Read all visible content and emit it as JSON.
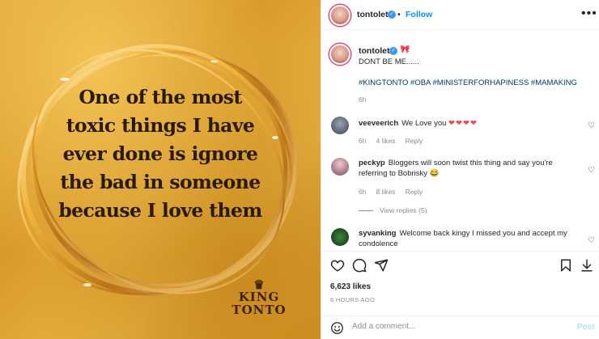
{
  "image": {
    "quote_lines": [
      "One of the most",
      "toxic things I have",
      "ever done is ignore",
      "the bad in someone",
      "because I love them"
    ],
    "brand_line1": "KING",
    "brand_line2": "TONTO",
    "crown_glyph": "♛"
  },
  "header": {
    "username": "tontolet",
    "separator": "•",
    "follow_label": "Follow",
    "more_glyph": "•••"
  },
  "caption": {
    "username": "tontolet",
    "emoji": "🎀",
    "text": "DONT BE ME......",
    "hashtags": "#KINGTONTO #OBA #MINISTERFORHAPINESS #MAMAKING",
    "time": "6h"
  },
  "comments": [
    {
      "username": "veeveerich",
      "text": "We Love you",
      "hearts": "❤❤❤❤",
      "time": "6h",
      "likes": "4 likes",
      "reply": "Reply"
    },
    {
      "username": "peckyp",
      "text": "Bloggers will soon twist this thing and say you're referring to Bobrisky 😂",
      "time": "6h",
      "likes": "8 likes",
      "reply": "Reply",
      "view_replies": "View replies (5)"
    },
    {
      "username": "syvanking",
      "text": "Welcome back kingy I missed you and accept my condolence"
    }
  ],
  "post_stats": {
    "likes": "6,623 likes",
    "time_ago": "6 HOURS AGO"
  },
  "add_comment": {
    "placeholder": "Add a comment...",
    "post_label": "Post"
  },
  "colors": {
    "link_blue": "#0095f6",
    "hashtag": "#00376b",
    "heart_red": "#ed4956",
    "gold": "#e3a83a"
  }
}
